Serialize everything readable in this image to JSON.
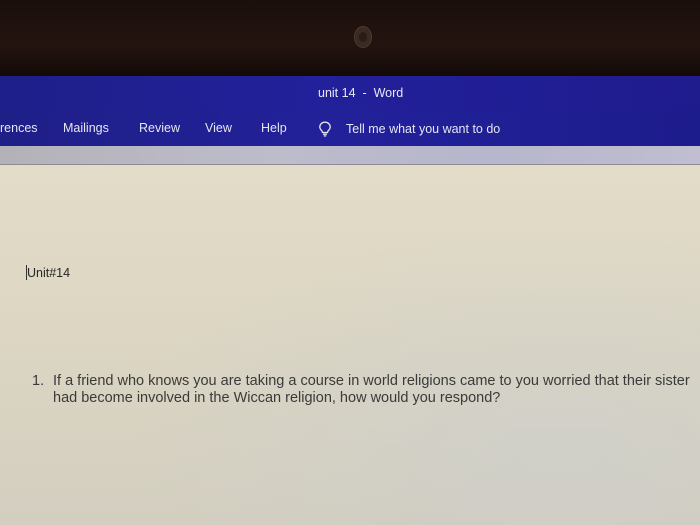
{
  "window": {
    "title": "unit 14  -  Word"
  },
  "ribbon": {
    "tabs": [
      {
        "label": "rences"
      },
      {
        "label": "Mailings"
      },
      {
        "label": "Review"
      },
      {
        "label": "View"
      },
      {
        "label": "Help"
      }
    ],
    "tell_me": {
      "icon": "lightbulb-icon",
      "placeholder": "Tell me what you want to do"
    }
  },
  "document": {
    "heading": "Unit#14",
    "questions": [
      {
        "number": "1.",
        "text": "If a friend who knows you are taking a course in world religions came to you worried that their sister had become involved in the Wiccan religion, how would you respond?"
      }
    ]
  },
  "colors": {
    "title_bar": "#22209a",
    "ribbon_strip": "#bdbccb",
    "document_bg": "#dcd6c3"
  }
}
